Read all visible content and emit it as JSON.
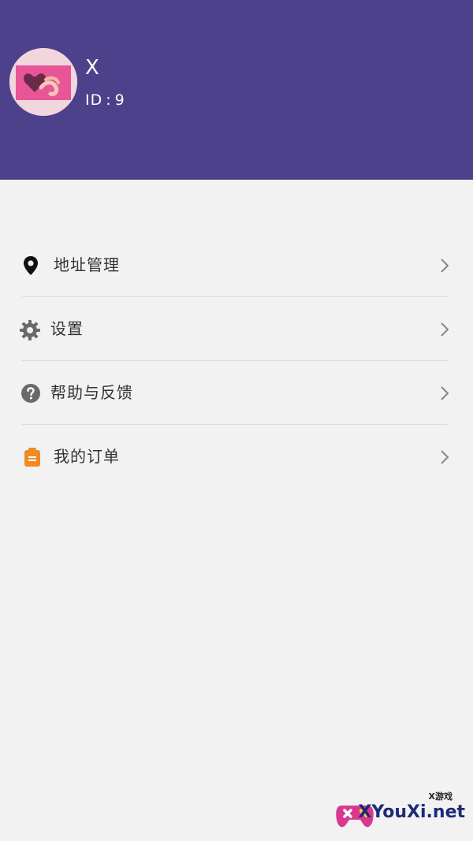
{
  "profile": {
    "name": "X",
    "id_label": "ID",
    "id_sep": ":",
    "id_value": "9"
  },
  "menu": {
    "items": [
      {
        "label": "地址管理",
        "icon": "location-pin-icon"
      },
      {
        "label": "设置",
        "icon": "gear-icon"
      },
      {
        "label": "帮助与反馈",
        "icon": "question-circle-icon"
      },
      {
        "label": "我的订单",
        "icon": "clipboard-icon"
      }
    ]
  },
  "watermark": {
    "small": "X游戏",
    "big": "XYouXi.net"
  },
  "colors": {
    "header": "#4e418b",
    "background": "#f2f2f2",
    "order_icon": "#f08a24",
    "icon_gray": "#6a6a6a"
  }
}
